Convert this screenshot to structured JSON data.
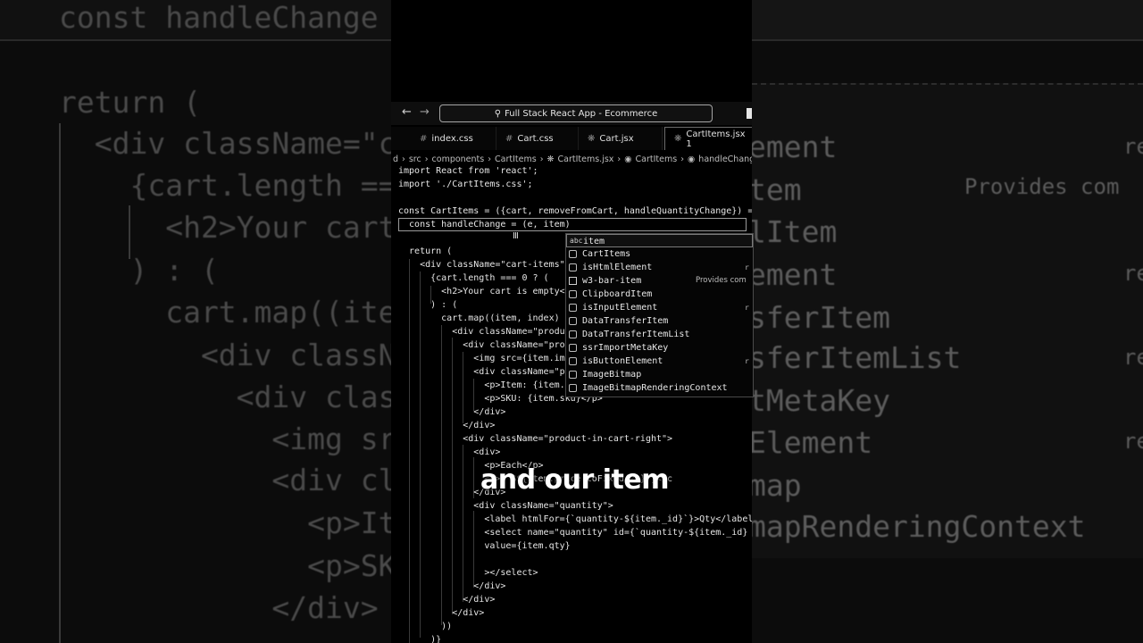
{
  "window": {
    "title": "Full Stack React App - Ecommerce",
    "back_icon": "arrow-left-icon",
    "forward_icon": "arrow-right-icon",
    "search_icon": "search-icon"
  },
  "tabs": [
    {
      "label": "index.css",
      "active": false
    },
    {
      "label": "Cart.css",
      "active": false
    },
    {
      "label": "Cart.jsx",
      "active": false
    },
    {
      "label": "CartItems.jsx 1",
      "active": true
    }
  ],
  "breadcrumb": [
    "d",
    "src",
    "components",
    "CartItems",
    "CartItems.jsx",
    "CartItems",
    "handleChange"
  ],
  "code_lines": [
    "import React from 'react';",
    "import './CartItems.css';",
    "",
    "const CartItems = ({cart, removeFromCart, handleQuantityChange}) =",
    "  const handleChange = (e, item)",
    "",
    "  return (",
    "    <div className=\"cart-items\"",
    "      {cart.length === 0 ? (",
    "        <h2>Your cart is empty<",
    "      ) : (",
    "        cart.map((item, index)",
    "          <div className=\"produ",
    "            <div className=\"pro",
    "              <img src={item.im",
    "              <div className=\"p",
    "                <p>Item: {item.",
    "                <p>SKU: {item.sku}</p>",
    "              </div>",
    "            </div>",
    "            <div className=\"product-in-cart-right\">",
    "              <div>",
    "                <p>Each</p>",
    "                <p>{`$${item.price.toFixed(2)}`}</c",
    "              </div>",
    "              <div className=\"quantity\">",
    "                <label htmlFor={`quantity-${item._id}`}>Qty</label",
    "                <select name=\"quantity\" id={`quantity-${item._id}",
    "                value={item.qty}",
    "",
    "                ></select>",
    "              </div>",
    "            </div>",
    "          </div>",
    "        ))",
    "      )}"
  ],
  "suggestions": [
    {
      "kind": "abc",
      "label": "item",
      "selected": true,
      "right": ""
    },
    {
      "kind": "cube",
      "label": "CartItems",
      "selected": false,
      "right": ""
    },
    {
      "kind": "cube",
      "label": "isHtmlElement",
      "selected": false,
      "right": "r"
    },
    {
      "kind": "box",
      "label": "w3-bar-item",
      "selected": false,
      "detail": "Provides com"
    },
    {
      "kind": "cube",
      "label": "ClipboardItem",
      "selected": false,
      "right": ""
    },
    {
      "kind": "cube",
      "label": "isInputElement",
      "selected": false,
      "right": "r"
    },
    {
      "kind": "cube",
      "label": "DataTransferItem",
      "selected": false,
      "right": ""
    },
    {
      "kind": "cube",
      "label": "DataTransferItemList",
      "selected": false,
      "right": ""
    },
    {
      "kind": "cube",
      "label": "ssrImportMetaKey",
      "selected": false,
      "right": ""
    },
    {
      "kind": "cube",
      "label": "isButtonElement",
      "selected": false,
      "right": "r"
    },
    {
      "kind": "cube",
      "label": "ImageBitmap",
      "selected": false,
      "right": ""
    },
    {
      "kind": "cube",
      "label": "ImageBitmapRenderingContext",
      "selected": false,
      "right": ""
    }
  ],
  "caption": "and our item",
  "bg_left_lines": [
    "const handleChange =",
    "return (",
    "  <div className=\"ca",
    "    {cart.length ===",
    "      <h2>Your cart",
    "    ) : (",
    "      cart.map((item",
    "        <div classNa",
    "          <div class",
    "            <img src",
    "            <div cla",
    "              <p>Ite",
    "              <p>SKU",
    "            </div>",
    "          </div>"
  ],
  "bg_right_lines": [
    "ement",
    "tem",
    "lItem",
    "ement",
    "sferItem",
    "sferItemList",
    "tMetaKey",
    "Element",
    "map",
    "mapRenderingContext"
  ],
  "bg_right_extra": [
    "re",
    "Provides com",
    "re",
    "re",
    "re"
  ]
}
